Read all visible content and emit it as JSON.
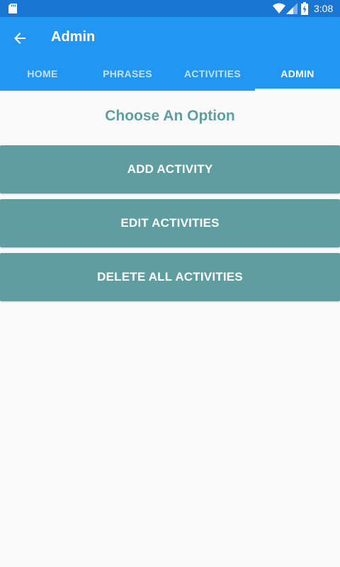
{
  "status_bar": {
    "time": "3:08",
    "icons": [
      "sd-card-icon",
      "wifi-icon",
      "signal-icon",
      "battery-icon"
    ]
  },
  "app_bar": {
    "title": "Admin",
    "back_icon": "arrow-back-icon"
  },
  "tabs": [
    {
      "label": "HOME",
      "active": false
    },
    {
      "label": "PHRASES",
      "active": false
    },
    {
      "label": "ACTIVITIES",
      "active": false
    },
    {
      "label": "ADMIN",
      "active": true
    }
  ],
  "content": {
    "heading": "Choose An Option",
    "buttons": [
      {
        "label": "ADD ACTIVITY"
      },
      {
        "label": "EDIT ACTIVITIES"
      },
      {
        "label": "DELETE ALL ACTIVITIES"
      }
    ]
  },
  "colors": {
    "status_bar": "#1976d2",
    "app_bar": "#2196f3",
    "accent": "#5f9ea0",
    "background": "#fafafa"
  }
}
